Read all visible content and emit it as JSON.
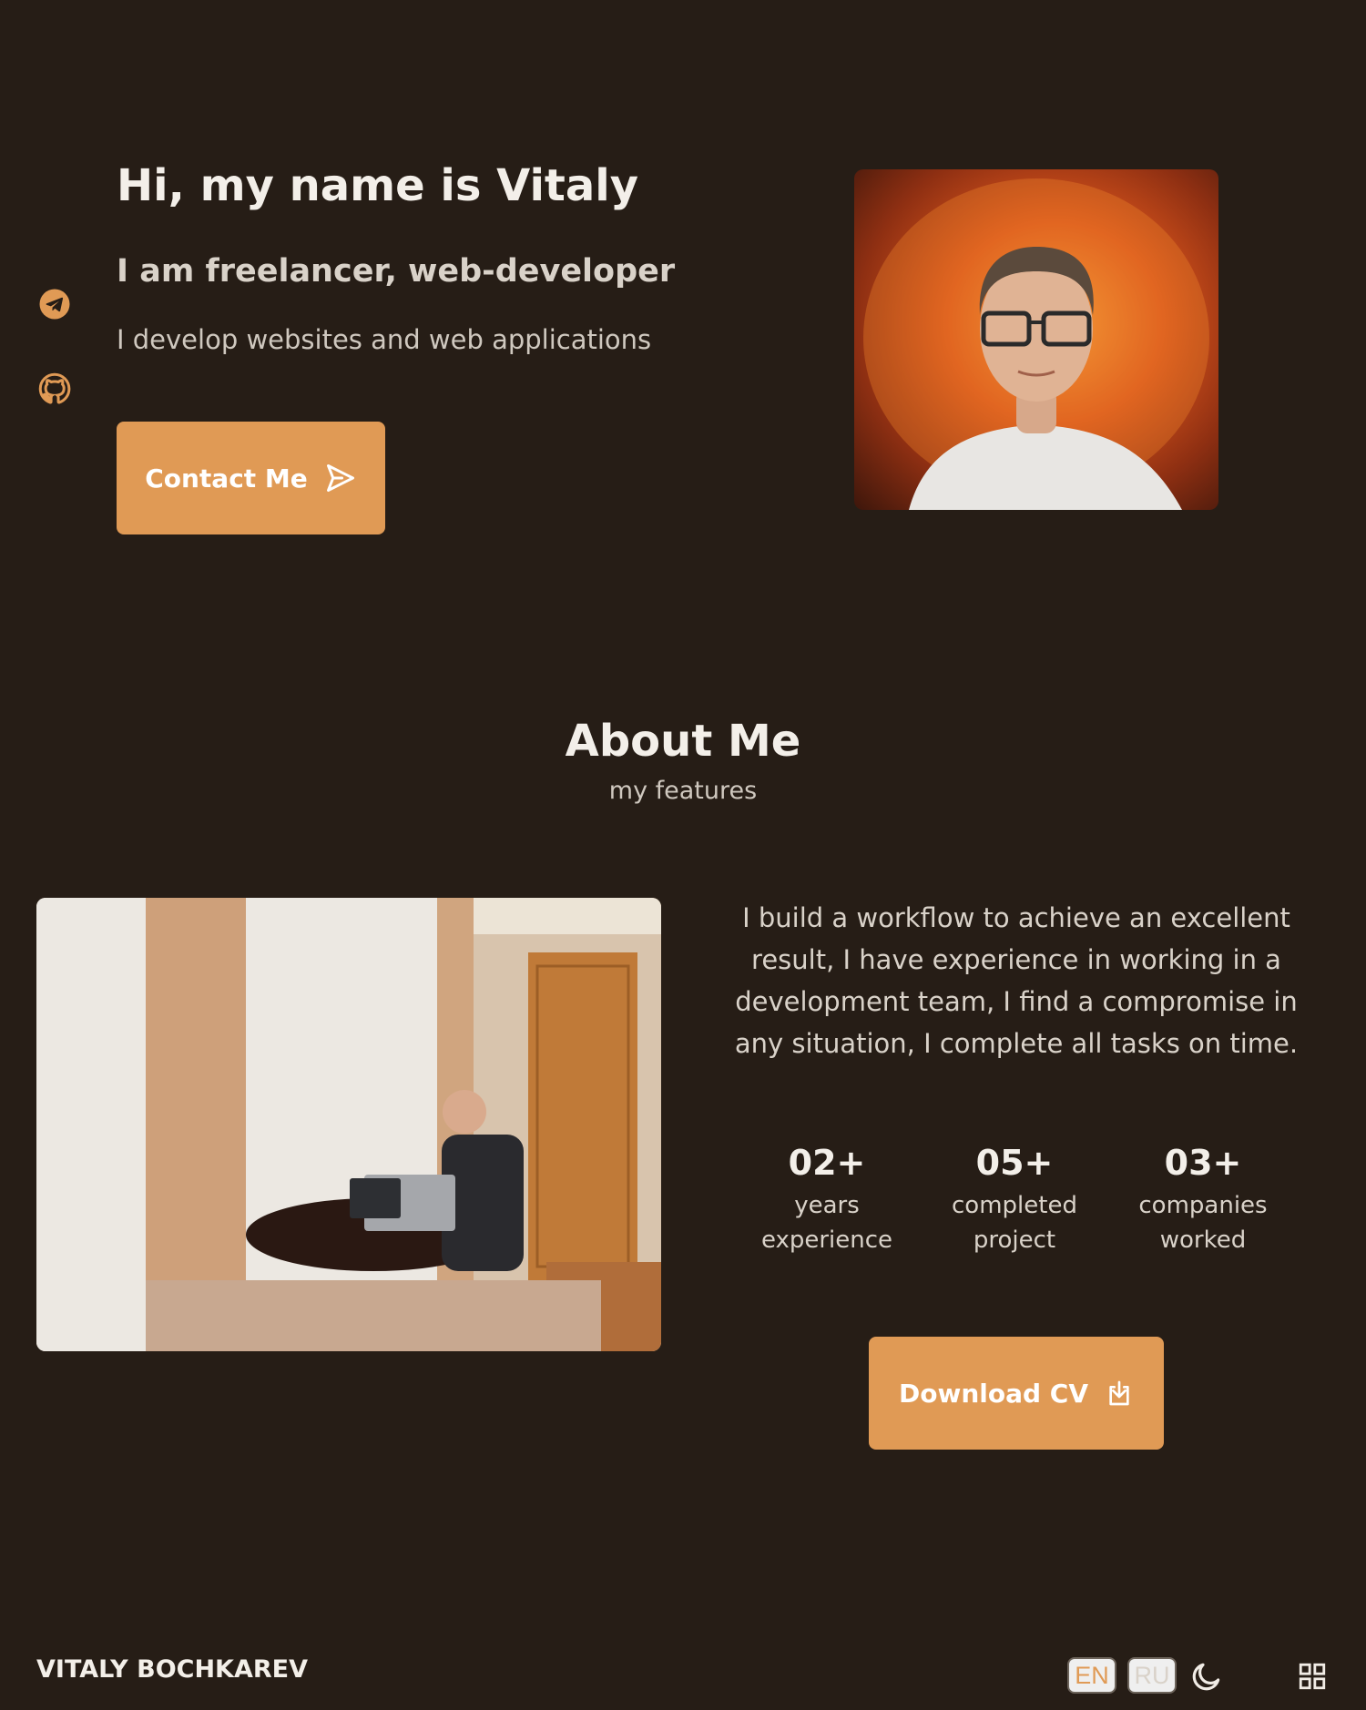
{
  "social": {
    "telegram_icon": "telegram-icon",
    "github_icon": "github-icon"
  },
  "hero": {
    "title": "Hi, my name is Vitaly",
    "subtitle": "I am freelancer, web-developer",
    "description": "I develop websites and web applications",
    "contact_label": "Contact Me"
  },
  "about": {
    "title": "About Me",
    "subtitle": "my features",
    "text": "I build a workflow to achieve an excellent result, I have experience in working in a development team, I find a compromise in any situation, I complete all tasks on time.",
    "stats": [
      {
        "value": "02+",
        "label_1": "years",
        "label_2": "experience"
      },
      {
        "value": "05+",
        "label_1": "completed",
        "label_2": "project"
      },
      {
        "value": "03+",
        "label_1": "companies",
        "label_2": "worked"
      }
    ],
    "download_label": "Download CV"
  },
  "footer": {
    "brand": "VITALY BOCHKAREV",
    "lang_en": "EN",
    "lang_ru": "RU",
    "active_language": "EN"
  },
  "colors": {
    "background": "#261d16",
    "accent": "#e09a55",
    "text": "#f3efe9"
  }
}
